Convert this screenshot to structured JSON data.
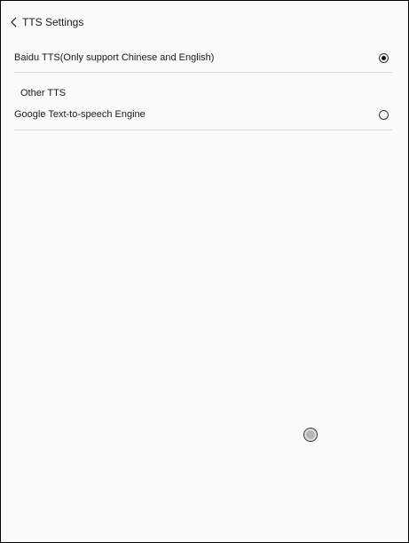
{
  "header": {
    "title": "TTS Settings",
    "back_icon": "chevron-left-icon"
  },
  "engines": {
    "baidu": {
      "label": "Baidu TTS(Only support Chinese and English)",
      "selected": true
    },
    "section_label": "Other TTS",
    "google": {
      "label": "Google Text-to-speech Engine",
      "selected": false
    }
  },
  "touch_indicator": {
    "icon": "touch-point-icon"
  }
}
